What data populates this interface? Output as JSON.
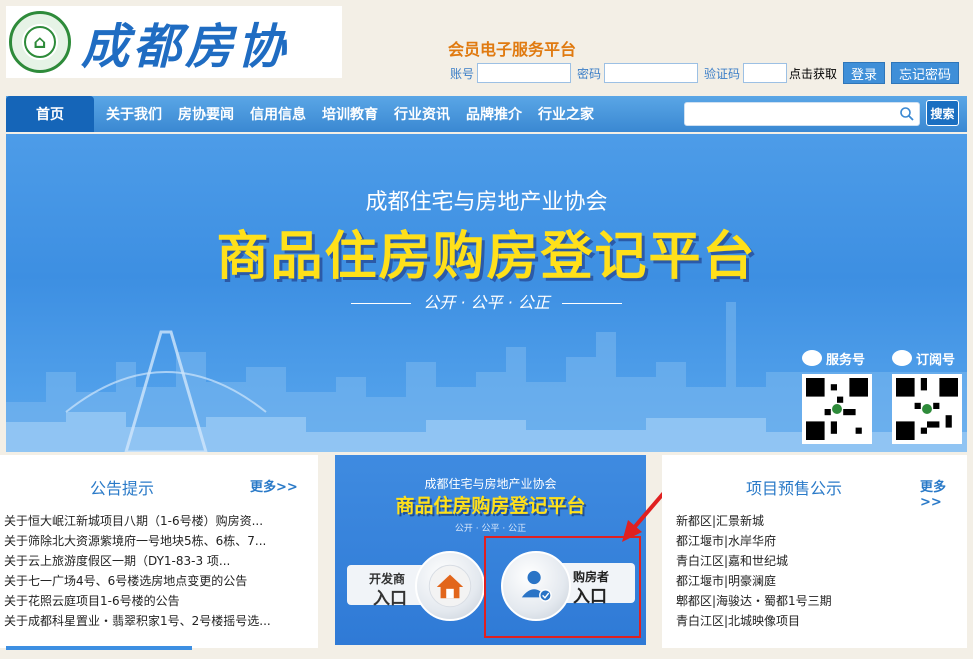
{
  "header": {
    "logo_text": "成都房协",
    "platform_title": "会员电子服务平台",
    "account_label": "账号",
    "password_label": "密码",
    "captcha_label": "验证码",
    "captcha_action": "点击获取",
    "login_button": "登录",
    "forgot_button": "忘记密码"
  },
  "nav": {
    "items": [
      "首页",
      "关于我们",
      "房协要闻",
      "信用信息",
      "培训教育",
      "行业资讯",
      "品牌推介",
      "行业之家"
    ],
    "search_button": "搜索",
    "search_placeholder": ""
  },
  "banner": {
    "org": "成都住宅与房地产业协会",
    "title": "商品住房购房登记平台",
    "slogan": "公开 · 公平 · 公正",
    "qr_service_label": "服务号",
    "qr_subscribe_label": "订阅号"
  },
  "notice_panel": {
    "title": "公告提示",
    "more": "更多>>",
    "items": [
      "关于恒大岷江新城项目八期（1-6号楼）购房资...",
      "关于筛除北大资源紫境府一号地块5栋、6栋、7...",
      "关于云上旅游度假区一期（DY1-83-3 项...",
      "关于七一广场4号、6号楼选房地点变更的公告",
      "关于花照云庭项目1-6号楼的公告",
      "关于成都科星置业・翡翠积家1号、2号楼摇号选..."
    ]
  },
  "center_panel": {
    "org": "成都住宅与房地产业协会",
    "title": "商品住房购房登记平台",
    "slogan": "公开 · 公平 · 公正",
    "developer_small": "开发商",
    "developer_big": "入口",
    "buyer_small": "购房者",
    "buyer_big": "入口"
  },
  "presale_panel": {
    "title": "项目预售公示",
    "more": "更多>>",
    "items": [
      "新都区|汇景新城",
      "都江堰市|水岸华府",
      "青白江区|嘉和世纪城",
      "都江堰市|明豪澜庭",
      "郫都区|海骏达・蜀都1号三期",
      "青白江区|北城映像项目"
    ]
  },
  "colors": {
    "accent": "#3a88d2",
    "nav_active": "#1565b8",
    "banner_title": "#ffe01a",
    "highlight": "#e02020",
    "platform_title": "#e07a10"
  }
}
